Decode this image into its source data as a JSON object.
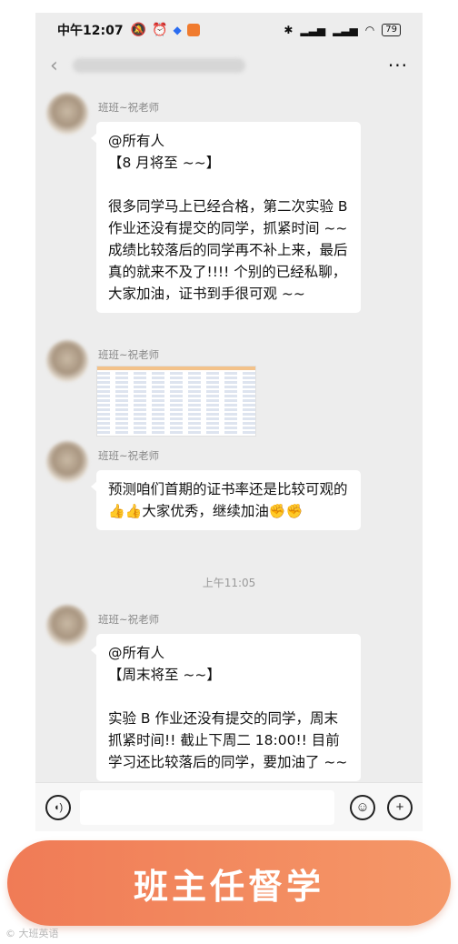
{
  "status_bar": {
    "time": "中午12:07",
    "left_icons": [
      "mute-icon",
      "alarm-icon",
      "app-badge-icon",
      "app-notification-icon"
    ],
    "right_icons": [
      "bluetooth-icon",
      "signal-hd1-icon",
      "signal-hd2-icon",
      "wifi-icon"
    ],
    "battery": "79"
  },
  "nav": {
    "back_icon": "‹",
    "more_icon": "···",
    "title_blurred": true
  },
  "messages": [
    {
      "sender": "班班~祝老师",
      "lines": [
        "@所有人",
        "【8 月将至 ~~】",
        "",
        "很多同学马上已经合格，第二次实验 B 作业还没有提交的同学，抓紧时间 ~~ 成绩比较落后的同学再不补上来，最后真的就来不及了!!!! 个别的已经私聊，大家加油，证书到手很可观 ~~"
      ]
    },
    {
      "sender": "班班~祝老师",
      "image": "spreadsheet-screenshot"
    },
    {
      "sender": "班班~祝老师",
      "text_before": "预测咱们首期的证书率还是比较可观的",
      "emojis": "👍👍",
      "text_after": "大家优秀，继续加油",
      "fist_emojis": "✊✊"
    },
    {
      "timestamp": "上午11:05"
    },
    {
      "sender": "班班~祝老师",
      "lines": [
        "@所有人",
        "【周末将至 ~~】",
        "",
        "实验 B 作业还没有提交的同学，周末抓紧时间!! 截止下周二 18:00!! 目前学习还比较落后的同学，要加油了 ~~"
      ]
    }
  ],
  "input_bar": {
    "voice_icon": "voice-icon",
    "emoji_icon": "☺",
    "plus_icon": "+"
  },
  "cta": {
    "label": "班主任督学",
    "color_start": "#f07b56",
    "color_end": "#f59868"
  },
  "watermark": "© 大班英语"
}
